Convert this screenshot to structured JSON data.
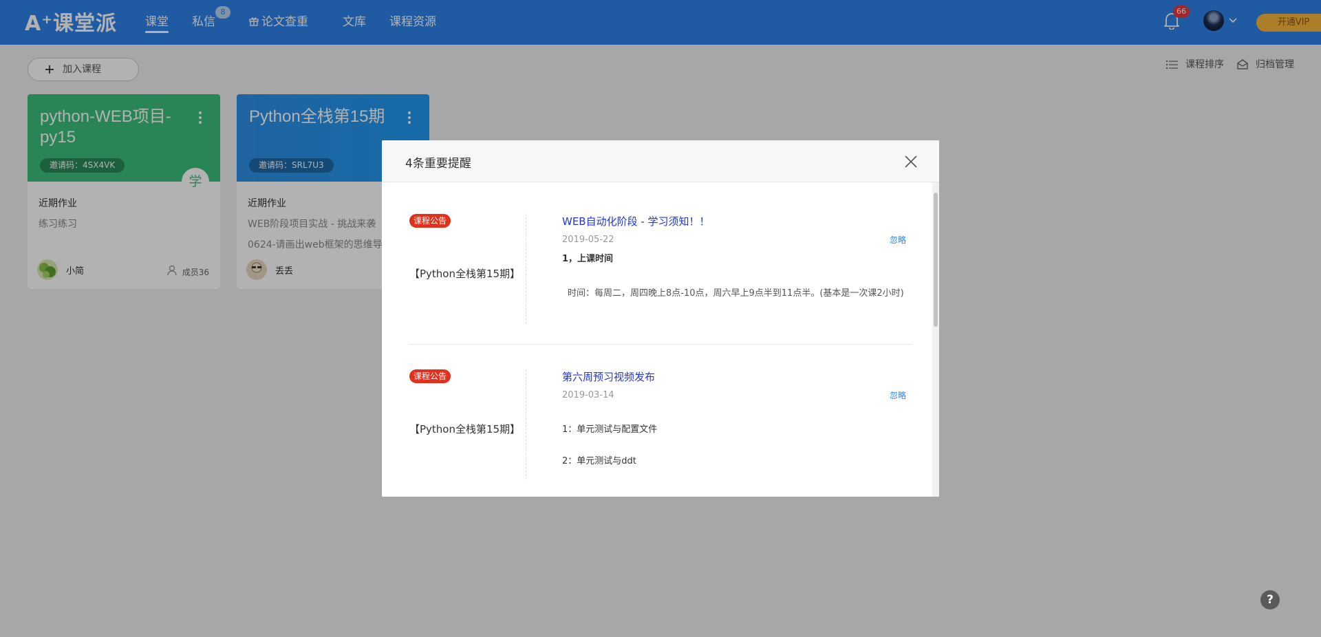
{
  "header": {
    "logo": "A⁺课堂派",
    "nav": [
      {
        "label": "课堂",
        "active": true
      },
      {
        "label": "私信",
        "badge": "8"
      },
      {
        "label": "论文查重",
        "icon": "gift-icon"
      },
      {
        "label": "文库"
      },
      {
        "label": "课程资源"
      }
    ],
    "bell_badge": "66",
    "vip_label": "开通VIP",
    "colors": {
      "bar": "#2f82e8",
      "vip": "#f6b53c",
      "badge": "#e8383d"
    }
  },
  "toolbar": {
    "add_course": "加入课程",
    "sort": "课程排序",
    "archive": "归档管理"
  },
  "courses": [
    {
      "title": "python-WEB项目-py15",
      "invite": "邀请码：4SX4VK",
      "role": "学",
      "homework_label": "近期作业",
      "homework": [
        "练习练习"
      ],
      "teacher": "小简",
      "members": "成员36",
      "color": "#3bbf7a"
    },
    {
      "title": "Python全栈第15期",
      "invite": "邀请码：SRL7U3",
      "homework_label": "近期作业",
      "homework": [
        "WEB阶段项目实战 - 挑战来袭",
        "0624-请画出web框架的思维导"
      ],
      "teacher": "丢丢",
      "color": "#2f8fe8"
    }
  ],
  "modal": {
    "title": "4条重要提醒",
    "notices": [
      {
        "tag": "课程公告",
        "course": "【Python全栈第15期】",
        "title": "WEB自动化阶段 - 学习须知！！",
        "date": "2019-05-22",
        "ignore": "忽略",
        "lines": [
          "1，上课时间",
          "时间：每周二，周四晚上8点-10点，周六早上9点半到11点半。(基本是一次课2小时)"
        ]
      },
      {
        "tag": "课程公告",
        "course": "【Python全栈第15期】",
        "title": "第六周预习视频发布",
        "date": "2019-03-14",
        "ignore": "忽略",
        "lines": [
          "1：单元测试与配置文件",
          "2：单元测试与ddt"
        ]
      }
    ]
  },
  "help": "?"
}
